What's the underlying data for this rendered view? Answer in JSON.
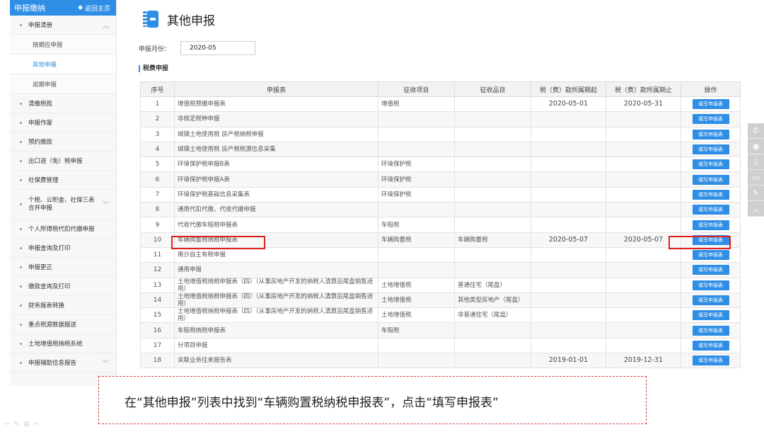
{
  "sidebar": {
    "header": "申报缴纳",
    "back_label": "返回主页",
    "items": [
      {
        "label": "申报清册",
        "expanded": true
      },
      {
        "label": "按期应申报",
        "sub": true
      },
      {
        "label": "其他申报",
        "sub": true,
        "active": true
      },
      {
        "label": "逾期申报",
        "sub": true
      },
      {
        "label": "清缴税款"
      },
      {
        "label": "申报作废"
      },
      {
        "label": "预约缴款"
      },
      {
        "label": "出口退（免）税申报"
      },
      {
        "label": "社保费管理"
      },
      {
        "label": "个税、公积金、社保三表合并申报",
        "line1": "个税、公积金、社保三表",
        "line2": "合并申报"
      },
      {
        "label": "个人所得税代扣代缴申报"
      },
      {
        "label": "申报查询及打印"
      },
      {
        "label": "申报更正"
      },
      {
        "label": "缴款查询及打印"
      },
      {
        "label": "财务报表转换"
      },
      {
        "label": "重点税源数据报送"
      },
      {
        "label": "土地增值税纳税系统"
      },
      {
        "label": "申报辅助信息报告"
      }
    ]
  },
  "page": {
    "title": "其他申报",
    "period_label": "申报月份：",
    "period_value": "2020-05",
    "section_title": "税费申报"
  },
  "table": {
    "headers": [
      "序号",
      "申报表",
      "征收项目",
      "征收品目",
      "税（费）款所属期起",
      "税（费）款所属期止",
      "操作"
    ],
    "action_label": "填写申报表",
    "rows": [
      {
        "no": "1",
        "form": "增值税预缴申报表",
        "item": "增值税",
        "sub": "",
        "start": "2020-05-01",
        "end": "2020-05-31"
      },
      {
        "no": "2",
        "form": "非核定税种申报",
        "item": "",
        "sub": "",
        "start": "",
        "end": ""
      },
      {
        "no": "3",
        "form": "城镇土地使用税 房产税纳税申报",
        "item": "",
        "sub": "",
        "start": "",
        "end": ""
      },
      {
        "no": "4",
        "form": "城镇土地使用税 房产税税源信息采集",
        "item": "",
        "sub": "",
        "start": "",
        "end": ""
      },
      {
        "no": "5",
        "form": "环境保护税申报B表",
        "item": "环境保护税",
        "sub": "",
        "start": "",
        "end": ""
      },
      {
        "no": "6",
        "form": "环境保护税申报A表",
        "item": "环境保护税",
        "sub": "",
        "start": "",
        "end": ""
      },
      {
        "no": "7",
        "form": "环境保护税基础信息采集表",
        "item": "环境保护税",
        "sub": "",
        "start": "",
        "end": ""
      },
      {
        "no": "8",
        "form": "通用代扣代缴、代收代缴申报",
        "item": "",
        "sub": "",
        "start": "",
        "end": ""
      },
      {
        "no": "9",
        "form": "代收代缴车船税申报表",
        "item": "车船税",
        "sub": "",
        "start": "",
        "end": ""
      },
      {
        "no": "10",
        "form": "车辆购置税纳税申报表",
        "item": "车辆购置税",
        "sub": "车辆购置税",
        "start": "2020-05-07",
        "end": "2020-05-07"
      },
      {
        "no": "11",
        "form": "南沙自主有税申报",
        "item": "",
        "sub": "",
        "start": "",
        "end": ""
      },
      {
        "no": "12",
        "form": "通用申报",
        "item": "",
        "sub": "",
        "start": "",
        "end": ""
      },
      {
        "no": "13",
        "form": "土地增值税纳税申报表（四）（从事房地产开发的纳税人清算后尾盘销售适用）",
        "item": "土地增值税",
        "sub": "普通住宅（尾盘）",
        "start": "",
        "end": ""
      },
      {
        "no": "14",
        "form": "土地增值税纳税申报表（四）（从事房地产开发的纳税人清算后尾盘销售适用）",
        "item": "土地增值税",
        "sub": "其他类型房地产（尾盘）",
        "start": "",
        "end": ""
      },
      {
        "no": "15",
        "form": "土地增值税纳税申报表（四）（从事房地产开发的纳税人清算后尾盘销售适用）",
        "item": "土地增值税",
        "sub": "非普通住宅（尾盘）",
        "start": "",
        "end": ""
      },
      {
        "no": "16",
        "form": "车船税纳税申报表",
        "item": "车船税",
        "sub": "",
        "start": "",
        "end": ""
      },
      {
        "no": "17",
        "form": "分项目申报",
        "item": "",
        "sub": "",
        "start": "",
        "end": ""
      },
      {
        "no": "18",
        "form": "关联业务往来报告表",
        "item": "",
        "sub": "",
        "start": "2019-01-01",
        "end": "2019-12-31"
      }
    ]
  },
  "annotation": {
    "text": "在“其他申报”列表中找到“车辆购置税纳税申报表”，点击“填写申报表”",
    "color": "#d94040"
  },
  "colors": {
    "accent": "#2e8ee6",
    "highlight": "#e02020"
  },
  "right_tools": [
    "wechat-icon",
    "weibo-icon",
    "mobile-icon",
    "tablet-icon",
    "edit-icon",
    "back-to-top-icon"
  ]
}
